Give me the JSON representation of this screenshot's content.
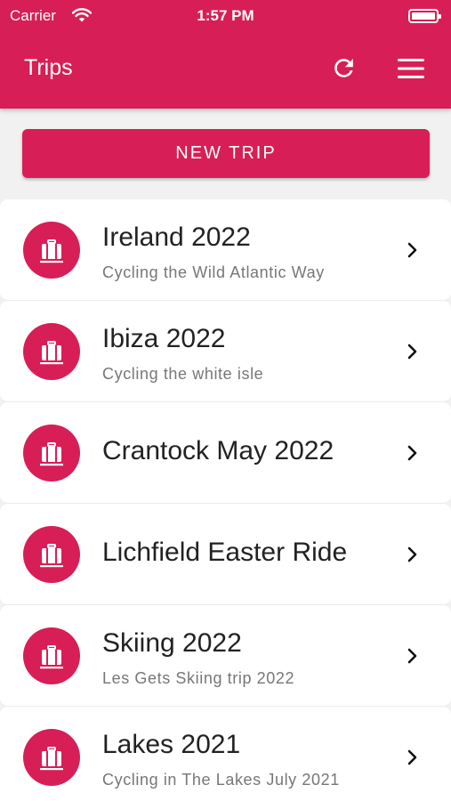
{
  "status_bar": {
    "carrier": "Carrier",
    "time": "1:57 PM"
  },
  "header": {
    "title": "Trips",
    "refresh_icon": "refresh-icon",
    "menu_icon": "hamburger-menu-icon"
  },
  "new_trip_button": {
    "label": "NEW TRIP"
  },
  "colors": {
    "accent": "#d81e56",
    "background": "#f1f1f1",
    "card": "#ffffff"
  },
  "trips": [
    {
      "title": "Ireland 2022",
      "subtitle": "Cycling the Wild Atlantic Way",
      "icon": "suitcase-icon"
    },
    {
      "title": "Ibiza 2022",
      "subtitle": "Cycling the white isle",
      "icon": "suitcase-icon"
    },
    {
      "title": "Crantock May 2022",
      "subtitle": "",
      "icon": "suitcase-icon"
    },
    {
      "title": "Lichfield Easter Ride",
      "subtitle": "",
      "icon": "suitcase-icon"
    },
    {
      "title": "Skiing 2022",
      "subtitle": "Les Gets Skiing trip 2022",
      "icon": "suitcase-icon"
    },
    {
      "title": "Lakes 2021",
      "subtitle": "Cycling in The Lakes July 2021",
      "icon": "suitcase-icon"
    }
  ]
}
